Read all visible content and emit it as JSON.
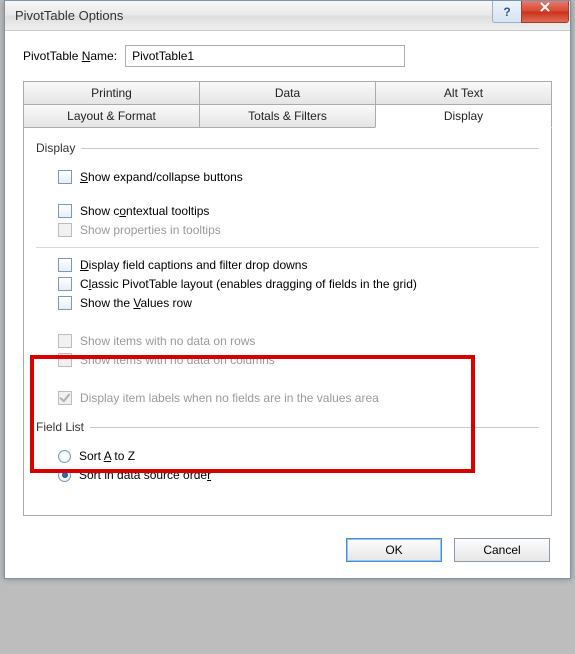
{
  "window": {
    "title": "PivotTable Options"
  },
  "name": {
    "label_pre": "PivotTable ",
    "label_u": "N",
    "label_post": "ame:",
    "value": "PivotTable1"
  },
  "tabs": {
    "top": [
      "Printing",
      "Data",
      "Alt Text"
    ],
    "bottom": [
      "Layout & Format",
      "Totals & Filters",
      "Display"
    ],
    "active": "Display"
  },
  "display_group": {
    "legend": "Display"
  },
  "opts": {
    "expand": {
      "pre": "",
      "u": "S",
      "post": "how expand/collapse buttons"
    },
    "tooltips": {
      "pre": "Show c",
      "u": "o",
      "post": "ntextual tooltips"
    },
    "props": {
      "text": "Show properties in tooltips"
    },
    "captions": {
      "pre": "",
      "u": "D",
      "post": "isplay field captions and filter drop downs"
    },
    "classic": {
      "pre": "C",
      "u": "l",
      "post": "assic PivotTable layout (enables dragging of fields in the grid)"
    },
    "valuesrow": {
      "pre": "Show the ",
      "u": "V",
      "post": "alues row"
    },
    "nodata_rows": {
      "text": "Show items with no data on rows"
    },
    "nodata_cols": {
      "text": "Show items with no data on columns"
    },
    "itemlabels": {
      "text": "Display item labels when no fields are in the values area"
    }
  },
  "fieldlist": {
    "legend": "Field List",
    "sort_az": {
      "pre": "Sort ",
      "u": "A",
      "post": " to Z"
    },
    "sort_src": {
      "pre": "Sort in data source orde",
      "u": "r",
      "post": ""
    }
  },
  "buttons": {
    "ok": "OK",
    "cancel": "Cancel"
  }
}
